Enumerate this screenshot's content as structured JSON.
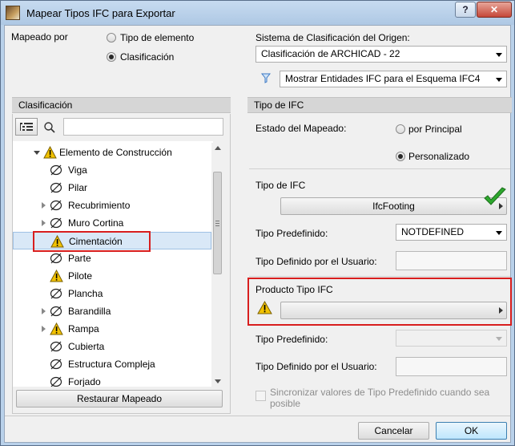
{
  "window": {
    "title": "Mapear Tipos IFC para Exportar"
  },
  "mapping": {
    "label": "Mapeado por",
    "option_element": "Tipo de elemento",
    "option_classification": "Clasificación"
  },
  "source": {
    "label": "Sistema de Clasificación del Origen:",
    "system": "Clasificación de ARCHICAD - 22",
    "filter": "Mostrar Entidades IFC para el Esquema IFC4"
  },
  "left_panel": {
    "header": "Clasificación",
    "search_placeholder": "",
    "tree": [
      {
        "label": "Elemento de Construcción",
        "icon": "warning-icon"
      },
      {
        "label": "Viga",
        "icon": "excluded-icon"
      },
      {
        "label": "Pilar",
        "icon": "excluded-icon"
      },
      {
        "label": "Recubrimiento",
        "icon": "excluded-icon"
      },
      {
        "label": "Muro Cortina",
        "icon": "excluded-icon"
      },
      {
        "label": "Cimentación",
        "icon": "warning-icon"
      },
      {
        "label": "Parte",
        "icon": "excluded-icon"
      },
      {
        "label": "Pilote",
        "icon": "warning-icon"
      },
      {
        "label": "Plancha",
        "icon": "excluded-icon"
      },
      {
        "label": "Barandilla",
        "icon": "excluded-icon"
      },
      {
        "label": "Rampa",
        "icon": "warning-icon"
      },
      {
        "label": "Cubierta",
        "icon": "excluded-icon"
      },
      {
        "label": "Estructura Compleja",
        "icon": "excluded-icon"
      },
      {
        "label": "Forjado",
        "icon": "excluded-icon"
      }
    ],
    "restore_button": "Restaurar Mapeado"
  },
  "right_panel": {
    "header": "Tipo de IFC",
    "mapping_state_label": "Estado del Mapeado:",
    "by_parent": "por Principal",
    "custom": "Personalizado",
    "ifc_type_label": "Tipo de IFC",
    "ifc_type_value": "IfcFooting",
    "predefined_label": "Tipo Predefinido:",
    "predefined_value": "NOTDEFINED",
    "user_defined_label": "Tipo Definido por el Usuario:",
    "product_type_label": "Producto Tipo IFC",
    "predefined_label_2": "Tipo Predefinido:",
    "user_defined_label_2": "Tipo Definido por el Usuario:",
    "sync_line1": "Sincronizar valores de Tipo Predefinido cuando sea",
    "sync_line2": "posible"
  },
  "footer": {
    "cancel": "Cancelar",
    "ok": "OK"
  },
  "colors": {
    "highlight_red": "#d81e1e",
    "warning_yellow": "#f2c200",
    "check_green": "#2ea82e"
  }
}
